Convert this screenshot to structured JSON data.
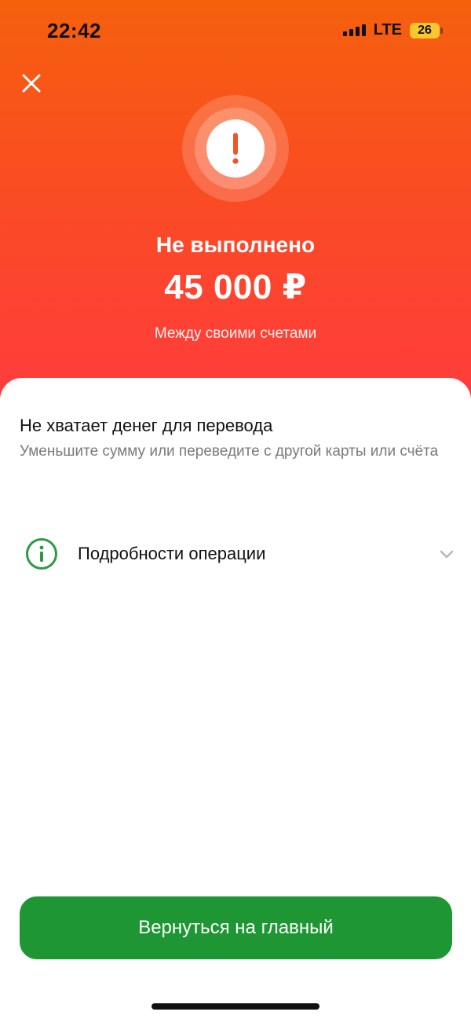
{
  "status_bar": {
    "time": "22:42",
    "network": "LTE",
    "battery": "26"
  },
  "hero": {
    "status_title": "Не выполнено",
    "amount": "45 000 ₽",
    "subtitle": "Между своими счетами"
  },
  "error": {
    "title": "Не хватает денег для перевода",
    "description": "Уменьшите сумму или переведите с другой карты или счёта"
  },
  "details": {
    "label": "Подробности операции"
  },
  "actions": {
    "home_button_label": "Вернуться на главный"
  },
  "colors": {
    "gradient_top": "#f5600d",
    "gradient_bottom": "#ff3a3f",
    "primary_green": "#1e9633",
    "info_icon_green": "#2b9a45"
  },
  "icons": {
    "close": "close-icon",
    "status": "exclamation-icon",
    "info": "info-icon",
    "chevron": "chevron-down-icon"
  }
}
